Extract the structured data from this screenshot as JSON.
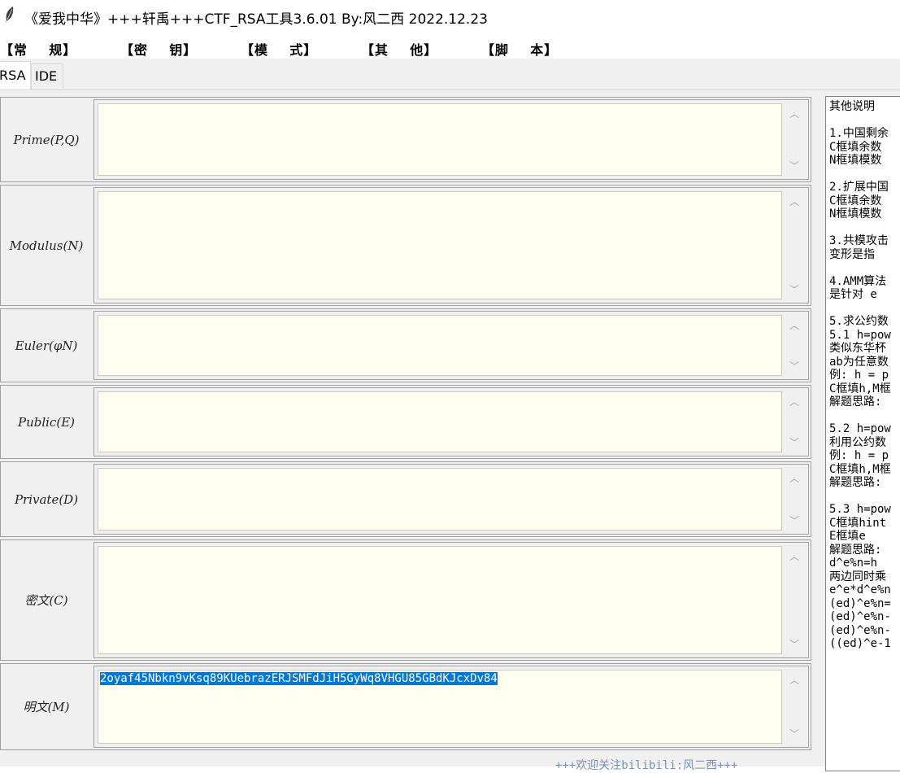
{
  "window": {
    "title": "《爱我中华》+++轩禹+++CTF_RSA工具3.6.01   By:风二西 2022.12.23",
    "icon": "feather-icon"
  },
  "menu": [
    {
      "label": "【常    规】"
    },
    {
      "label": "【密    钥】"
    },
    {
      "label": "【模    式】"
    },
    {
      "label": "【其    他】"
    },
    {
      "label": "【脚    本】"
    }
  ],
  "tabs": [
    {
      "label": "RSA",
      "active": true
    },
    {
      "label": "IDE",
      "active": false
    }
  ],
  "fields": [
    {
      "label": "Prime(P,Q)",
      "value": ""
    },
    {
      "label": "Modulus(N)",
      "value": ""
    },
    {
      "label": "Euler(φN)",
      "value": ""
    },
    {
      "label": "Public(E)",
      "value": ""
    },
    {
      "label": "Private(D)",
      "value": ""
    },
    {
      "label": "密文(C)",
      "value": ""
    },
    {
      "label": "明文(M)",
      "value": "2oyaf45Nbkn9vKsq89KUebrazERJSMFdJiH5GyWq8VHGU85GBdKJcxDv84"
    }
  ],
  "side_text": "其他说明\n\n1.中国剩余\nC框填余数\nN框填模数\n\n2.扩展中国\nC框填余数\nN框填模数\n\n3.共模攻击\n变形是指\n\n4.AMM算法\n是针对 e\n\n5.求公约数\n5.1 h=pow\n类似东华杯\nab为任意数\n例: h = p\nC框填h,M框\n解题思路:\n\n5.2 h=pow\n利用公约数\n例: h = p\nC框填h,M框\n解题思路:\n\n5.3 h=pow\nC框填hint\nE框填e\n解题思路:\nd^e%n=h\n两边同时乘\ne^e*d^e%n\n(ed)^e%n=\n(ed)^e%n-\n(ed)^e%n-\n((ed)^e-1",
  "footer": "+++欢迎关注bilibili:风二西+++",
  "colors": {
    "text_bg": "#fffff0",
    "selection": "#0078d7",
    "panel": "#f0f0f0"
  }
}
